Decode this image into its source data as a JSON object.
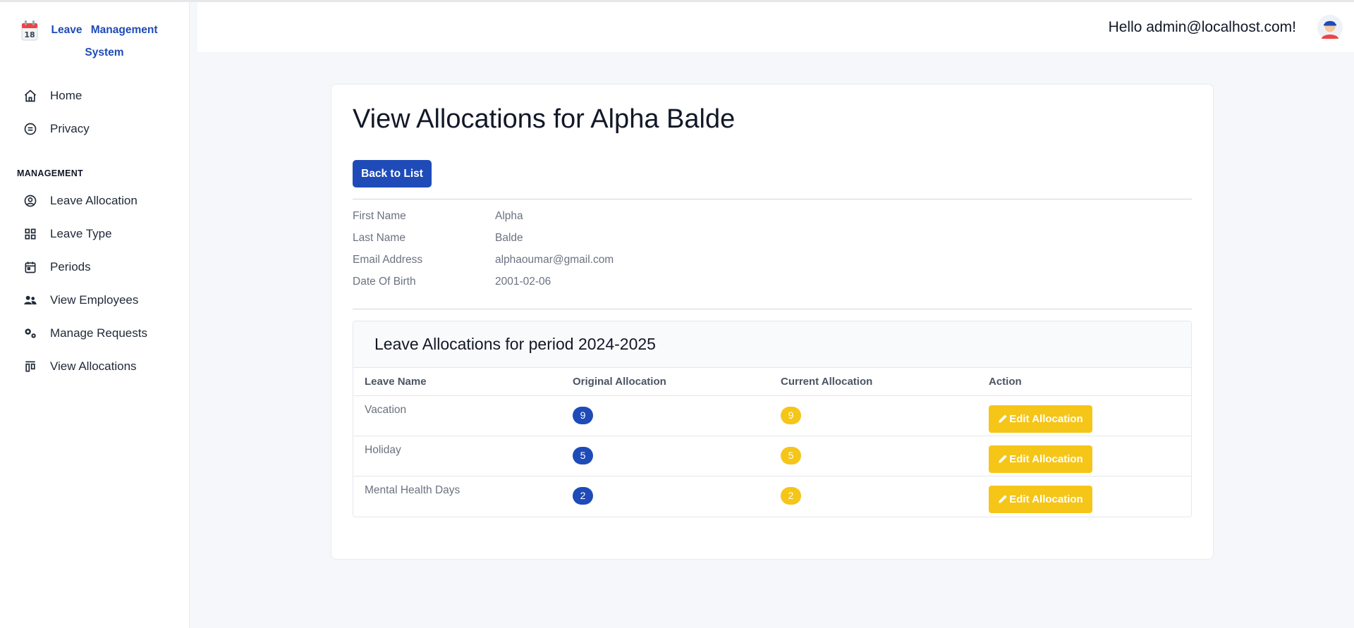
{
  "app": {
    "title": "Leave Management System",
    "title_line1": "Leave Management",
    "title_line2": "System"
  },
  "header": {
    "greeting": "Hello admin@localhost.com!"
  },
  "sidebar": {
    "top_items": [
      {
        "label": "Home",
        "icon": "home-icon"
      },
      {
        "label": "Privacy",
        "icon": "privacy-icon"
      }
    ],
    "section_label": "MANAGEMENT",
    "management_items": [
      {
        "label": "Leave Allocation",
        "icon": "user-circle-icon"
      },
      {
        "label": "Leave Type",
        "icon": "grid-icon"
      },
      {
        "label": "Periods",
        "icon": "calendar-icon"
      },
      {
        "label": "View Employees",
        "icon": "users-icon"
      },
      {
        "label": "Manage Requests",
        "icon": "gears-icon"
      },
      {
        "label": "View Allocations",
        "icon": "allocations-icon"
      }
    ]
  },
  "main": {
    "title": "View Allocations for Alpha Balde",
    "back_label": "Back to List",
    "details": [
      {
        "label": "First Name",
        "value": "Alpha"
      },
      {
        "label": "Last Name",
        "value": "Balde"
      },
      {
        "label": "Email Address",
        "value": "alphaoumar@gmail.com"
      },
      {
        "label": "Date Of Birth",
        "value": "2001-02-06"
      }
    ],
    "allocations": {
      "heading": "Leave Allocations for period 2024-2025",
      "columns": [
        "Leave Name",
        "Original Allocation",
        "Current Allocation",
        "Action"
      ],
      "rows": [
        {
          "name": "Vacation",
          "original": "9",
          "current": "9",
          "action": "Edit Allocation"
        },
        {
          "name": "Holiday",
          "original": "5",
          "current": "5",
          "action": "Edit Allocation"
        },
        {
          "name": "Mental Health Days",
          "original": "2",
          "current": "2",
          "action": "Edit Allocation"
        }
      ]
    }
  },
  "colors": {
    "primary": "#1e4bb8",
    "warning": "#f5c518",
    "background": "#f5f7fb"
  }
}
